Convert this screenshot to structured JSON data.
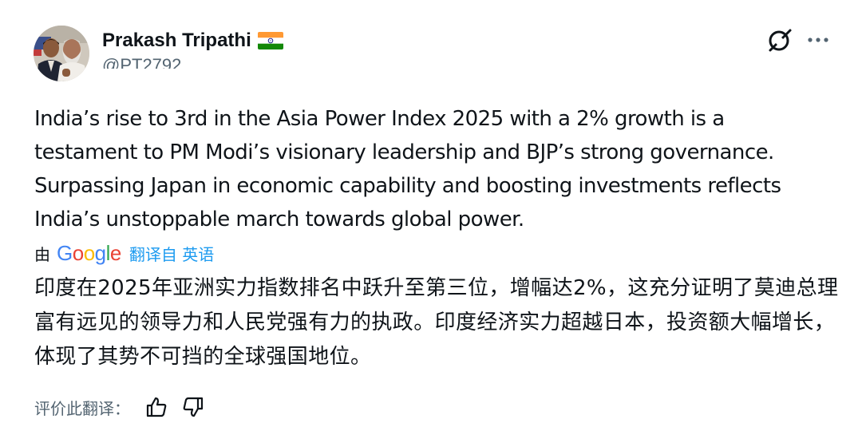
{
  "author": {
    "display_name": "Prakash Tripathi",
    "flag_emoji": "india-flag",
    "handle": "@PT2792"
  },
  "tweet": {
    "text": "India’s rise to 3rd in the Asia Power Index 2025 with a 2% growth is a testament to PM Modi’s visionary leadership and BJP’s strong governance. Surpassing Japan in economic capability and boosting investments reflects India’s unstoppable march towards global power."
  },
  "translation": {
    "by_label": "由",
    "provider": "Google",
    "from_label": "翻译自 英语",
    "text": "印度在2025年亚洲实力指数排名中跃升至第三位，增幅达2%，这充分证明了莫迪总理富有远见的领导力和人民党强有力的执政。印度经济实力超越日本，投资额大幅增长，体现了其势不可挡的全球强国地位。",
    "rate_label": "评价此翻译："
  },
  "colors": {
    "text": "#0f1419",
    "secondary": "#536471",
    "link": "#1d9bf0"
  },
  "icons": {
    "header_action": "grok-icon",
    "menu": "more-icon",
    "rate_good": "thumbs-up-icon",
    "rate_bad": "thumbs-down-icon"
  }
}
